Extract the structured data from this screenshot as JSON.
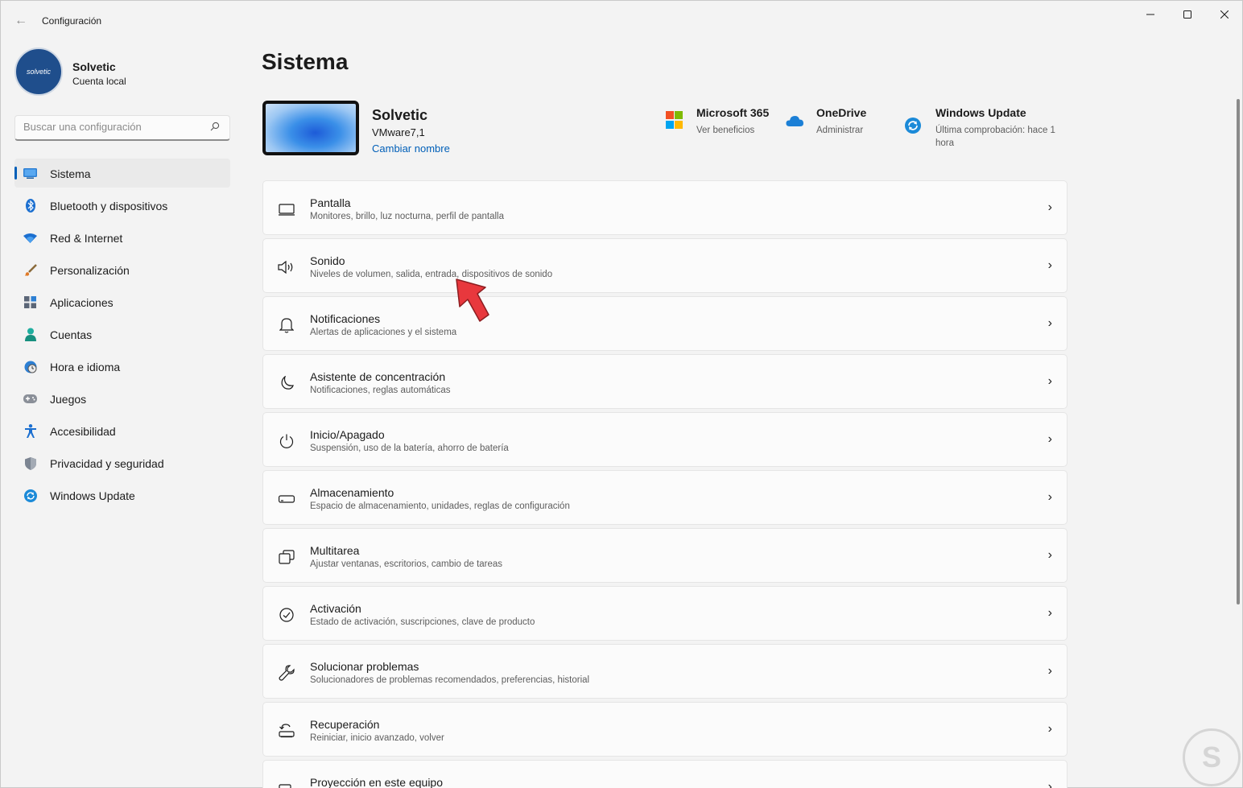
{
  "window": {
    "title": "Configuración",
    "back_icon": "arrow-left-icon",
    "controls": [
      "minimize-icon",
      "maximize-icon",
      "close-icon"
    ]
  },
  "profile": {
    "name": "Solvetic",
    "account_type": "Cuenta local",
    "avatar_text": "solvetic"
  },
  "search": {
    "placeholder": "Buscar una configuración",
    "icon": "search-icon"
  },
  "sidebar": {
    "items": [
      {
        "label": "Sistema",
        "icon": "monitor-icon",
        "active": true
      },
      {
        "label": "Bluetooth y dispositivos",
        "icon": "bluetooth-icon"
      },
      {
        "label": "Red & Internet",
        "icon": "wifi-icon"
      },
      {
        "label": "Personalización",
        "icon": "brush-icon"
      },
      {
        "label": "Aplicaciones",
        "icon": "apps-icon"
      },
      {
        "label": "Cuentas",
        "icon": "person-icon"
      },
      {
        "label": "Hora e idioma",
        "icon": "globe-clock-icon"
      },
      {
        "label": "Juegos",
        "icon": "gamepad-icon"
      },
      {
        "label": "Accesibilidad",
        "icon": "accessibility-icon"
      },
      {
        "label": "Privacidad y seguridad",
        "icon": "shield-icon"
      },
      {
        "label": "Windows Update",
        "icon": "update-icon"
      }
    ]
  },
  "main": {
    "title": "Sistema",
    "device": {
      "name": "Solvetic",
      "model": "VMware7,1",
      "rename_label": "Cambiar nombre"
    },
    "quick_links": [
      {
        "title": "Microsoft 365",
        "sub": "Ver beneficios",
        "icon": "microsoft-logo-icon"
      },
      {
        "title": "OneDrive",
        "sub": "Administrar",
        "icon": "cloud-icon"
      },
      {
        "title": "Windows Update",
        "sub": "Última comprobación: hace 1 hora",
        "icon": "update-icon"
      }
    ],
    "cards": [
      {
        "title": "Pantalla",
        "sub": "Monitores, brillo, luz nocturna, perfil de pantalla",
        "icon": "display-icon"
      },
      {
        "title": "Sonido",
        "sub": "Niveles de volumen, salida, entrada, dispositivos de sonido",
        "icon": "speaker-icon"
      },
      {
        "title": "Notificaciones",
        "sub": "Alertas de aplicaciones y el sistema",
        "icon": "bell-icon"
      },
      {
        "title": "Asistente de concentración",
        "sub": "Notificaciones, reglas automáticas",
        "icon": "moon-icon"
      },
      {
        "title": "Inicio/Apagado",
        "sub": "Suspensión, uso de la batería, ahorro de batería",
        "icon": "power-icon"
      },
      {
        "title": "Almacenamiento",
        "sub": "Espacio de almacenamiento, unidades, reglas de configuración",
        "icon": "storage-icon"
      },
      {
        "title": "Multitarea",
        "sub": "Ajustar ventanas, escritorios, cambio de tareas",
        "icon": "multitask-icon"
      },
      {
        "title": "Activación",
        "sub": "Estado de activación, suscripciones, clave de producto",
        "icon": "check-circle-icon"
      },
      {
        "title": "Solucionar problemas",
        "sub": "Solucionadores de problemas recomendados, preferencias, historial",
        "icon": "wrench-icon"
      },
      {
        "title": "Recuperación",
        "sub": "Reiniciar, inicio avanzado, volver",
        "icon": "recovery-icon"
      },
      {
        "title": "Proyección en este equipo",
        "sub": "",
        "icon": "projection-icon"
      }
    ]
  },
  "colors": {
    "accent": "#005fb8",
    "background": "#f3f3f3",
    "card": "#fbfbfb"
  }
}
